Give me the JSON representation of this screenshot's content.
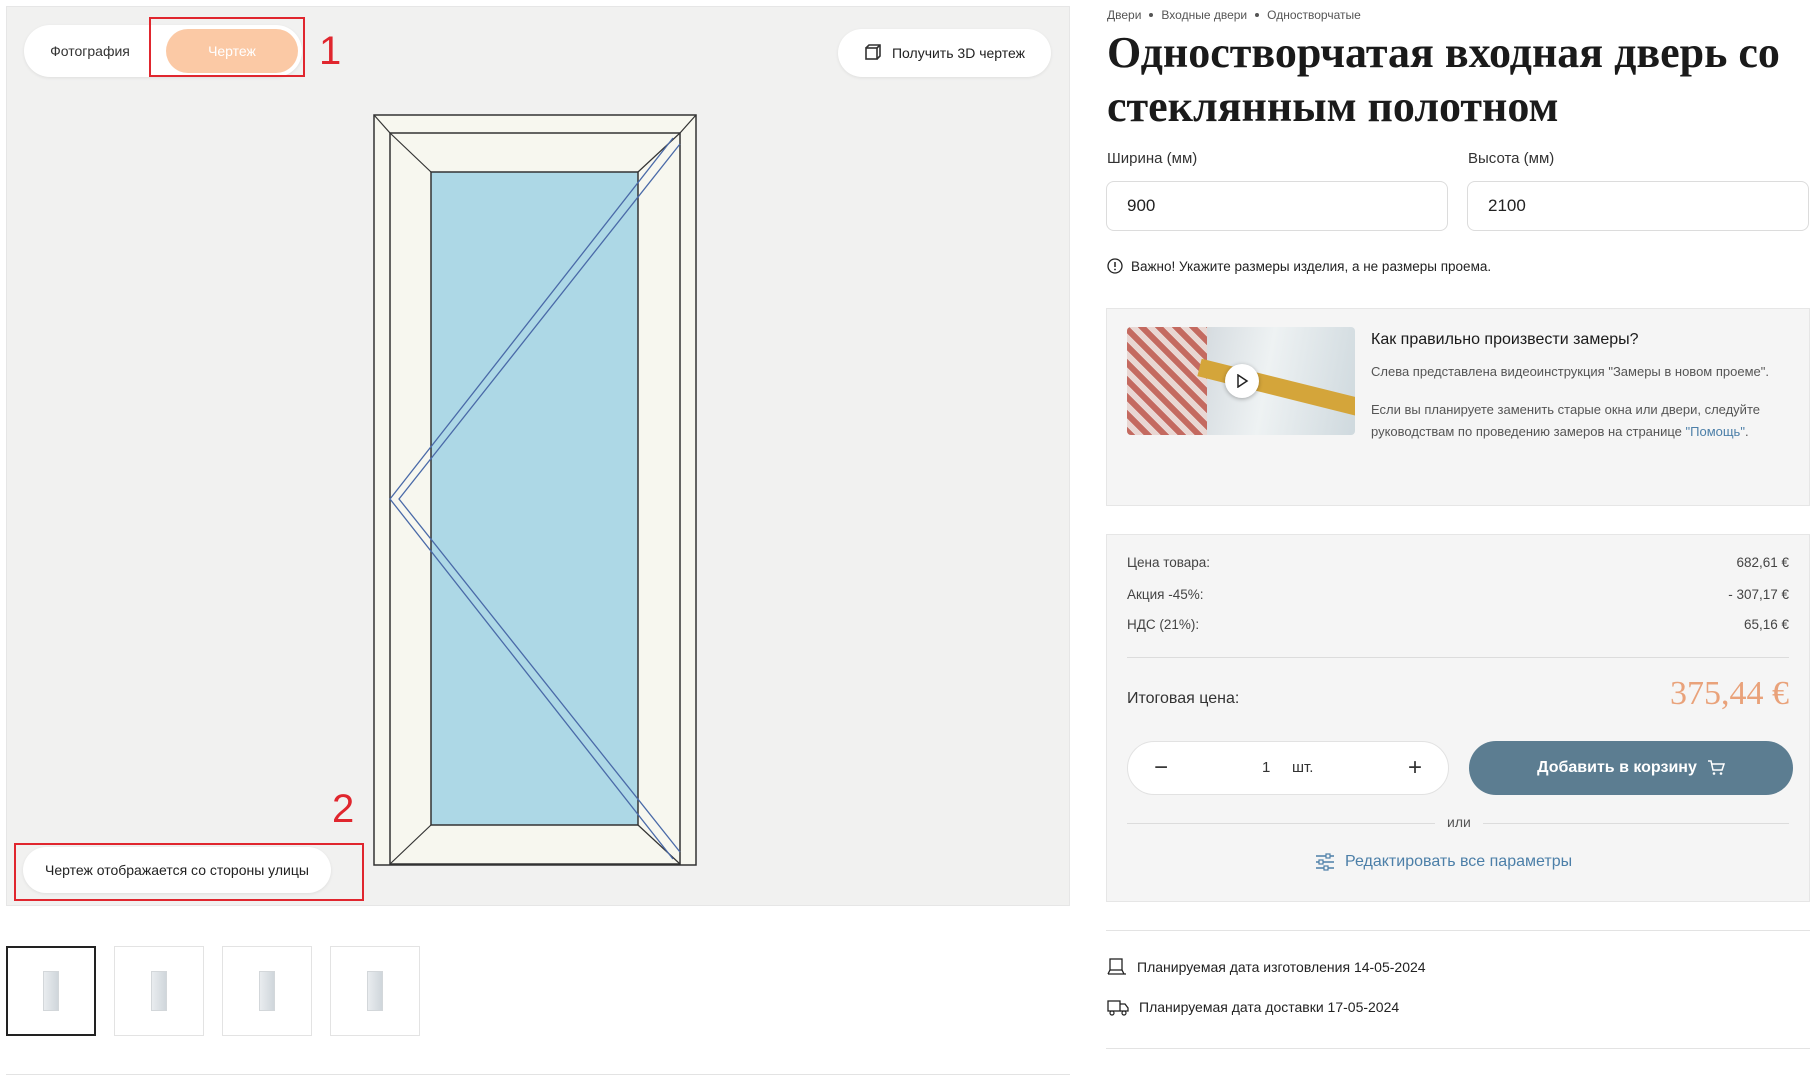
{
  "viewer": {
    "tab_photo": "Фотография",
    "tab_drawing": "Чертеж",
    "btn_3d": "Получить 3D чертеж",
    "side_note": "Чертеж отображается со стороны улицы",
    "annotations": [
      "1",
      "2"
    ]
  },
  "thumbnails": 4,
  "product": {
    "breadcrumbs": [
      "Двери",
      "Входные двери",
      "Одностворчатые"
    ],
    "title": "Одностворчатая входная дверь со стеклянным полотном",
    "width_label": "Ширина (мм)",
    "width_value": "900",
    "height_label": "Высота (мм)",
    "height_value": "2100",
    "note": "Важно! Укажите размеры изделия, а не размеры проема."
  },
  "howto": {
    "title": "Как правильно произвести замеры?",
    "text1": "Слева представлена видеоинструкция \"Замеры в новом проеме\".",
    "text2_prefix": "Если вы планируете заменить старые окна или двери, следуйте руководствам по проведению замеров на странице ",
    "text2_link": "\"Помощь\"",
    "text2_suffix": "."
  },
  "pricing": {
    "rows": [
      {
        "label": "Цена товара:",
        "value": "682,61 €"
      },
      {
        "label": "Акция -45%:",
        "value": "- 307,17 €"
      },
      {
        "label": "НДС (21%):",
        "value": "65,16 €"
      }
    ],
    "total_label": "Итоговая цена:",
    "total_value": "375,44 €",
    "quantity": "1",
    "unit": "шт.",
    "add_to_cart": "Добавить в корзину",
    "or": "или",
    "edit_all": "Редактировать все параметры"
  },
  "dates": {
    "manufacture": "Планируемая дата изготовления 14-05-2024",
    "delivery": "Планируемая дата доставки 17-05-2024"
  },
  "colors": {
    "accent_peach": "#fbc9a5",
    "total_price": "#e9a27a",
    "button_blue": "#5c7d91",
    "link": "#4c7fa8",
    "glass": "#add8e6",
    "frame": "#f7f7ef",
    "highlight": "#e0262e"
  }
}
